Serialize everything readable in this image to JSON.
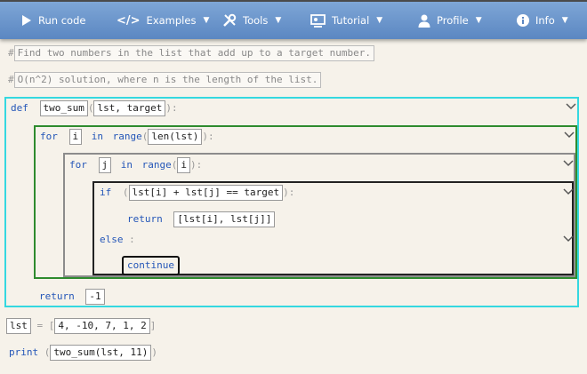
{
  "nav": {
    "run": "Run code",
    "examples": "Examples",
    "tools": "Tools",
    "tutorial": "Tutorial",
    "profile": "Profile",
    "info": "Info"
  },
  "comments": {
    "line1": "Find two numbers in the list that add up to a target number.",
    "line2": "O(n^2) solution, where n is the length of the list."
  },
  "code": {
    "def_kw": "def",
    "func_name": "two_sum",
    "params": "lst, target",
    "for_kw": "for",
    "in_kw": "in",
    "range_kw": "range",
    "outer_var": "i",
    "outer_iter": "len(lst)",
    "inner_var": "j",
    "inner_iter": "i",
    "if_kw": "if",
    "condition": "lst[i] + lst[j] == target",
    "return_kw": "return",
    "return_value": "[lst[i], lst[j]]",
    "else_kw": "else",
    "continue_kw": "continue",
    "return_default": "-1",
    "list_var": "lst",
    "list_value": "4, -10, 7, 1, 2",
    "print_kw": "print",
    "print_arg": "two_sum(lst, 11)"
  },
  "colors": {
    "nav_top": "#7ea6d6",
    "nav_bottom": "#5b87c2",
    "def_border": "#34d8e0",
    "for_outer_border": "#2e8b2e",
    "for_inner_border": "#8c8c8c",
    "if_border": "#222222",
    "keyword": "#2456b8"
  }
}
